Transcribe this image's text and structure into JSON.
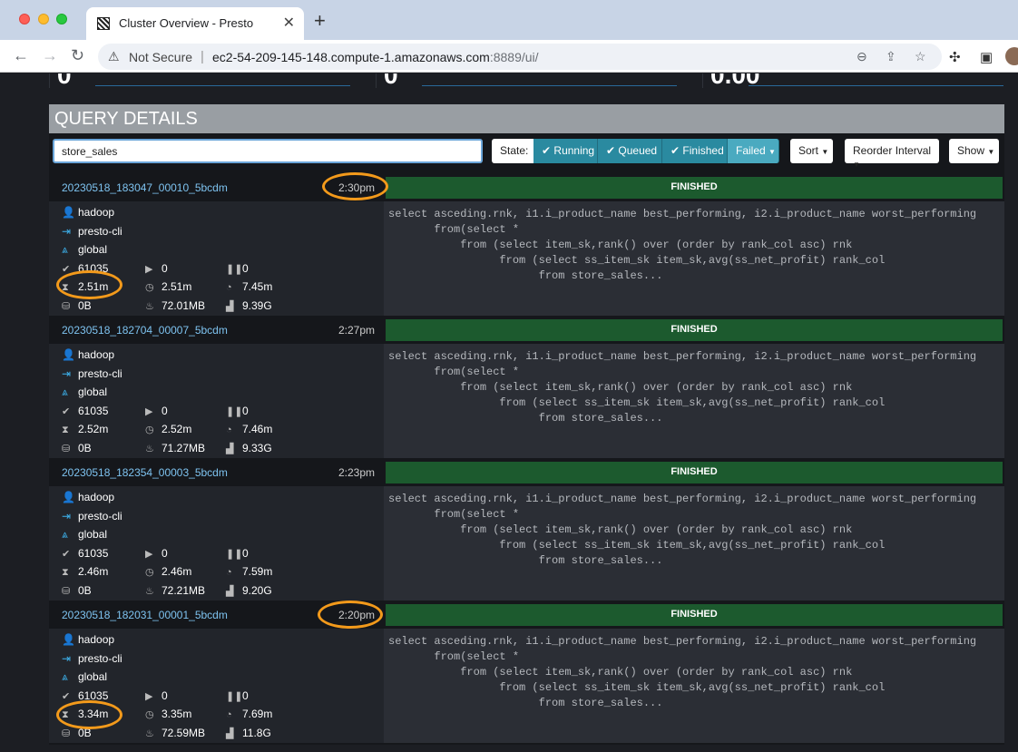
{
  "browser": {
    "tab_title": "Cluster Overview - Presto",
    "not_secure": "Not Secure",
    "url_host": "ec2-54-209-145-148.compute-1.amazonaws.com",
    "url_rest": ":8889/ui/"
  },
  "section": {
    "title": "QUERY DETAILS"
  },
  "filters": {
    "search_value": "store_sales",
    "state_label": "State:",
    "running": "Running",
    "queued": "Queued",
    "finished": "Finished",
    "failed": "Failed",
    "sort": "Sort",
    "reorder": "Reorder Interval",
    "show": "Show"
  },
  "queries": [
    {
      "id": "20230518_183047_00010_5bcdm",
      "time": "2:30pm",
      "status": "FINISHED",
      "user": "hadoop",
      "source": "presto-cli",
      "resource_group": "global",
      "completed_splits": "61035",
      "running_splits": "0",
      "queued_splits": "0",
      "wall_time": "2.51m",
      "elapsed_time": "2.51m",
      "cpu_time": "7.45m",
      "memory": "0B",
      "peak_memory": "72.01MB",
      "cumulative": "9.39G"
    },
    {
      "id": "20230518_182704_00007_5bcdm",
      "time": "2:27pm",
      "status": "FINISHED",
      "user": "hadoop",
      "source": "presto-cli",
      "resource_group": "global",
      "completed_splits": "61035",
      "running_splits": "0",
      "queued_splits": "0",
      "wall_time": "2.52m",
      "elapsed_time": "2.52m",
      "cpu_time": "7.46m",
      "memory": "0B",
      "peak_memory": "71.27MB",
      "cumulative": "9.33G"
    },
    {
      "id": "20230518_182354_00003_5bcdm",
      "time": "2:23pm",
      "status": "FINISHED",
      "user": "hadoop",
      "source": "presto-cli",
      "resource_group": "global",
      "completed_splits": "61035",
      "running_splits": "0",
      "queued_splits": "0",
      "wall_time": "2.46m",
      "elapsed_time": "2.46m",
      "cpu_time": "7.59m",
      "memory": "0B",
      "peak_memory": "72.21MB",
      "cumulative": "9.20G"
    },
    {
      "id": "20230518_182031_00001_5bcdm",
      "time": "2:20pm",
      "status": "FINISHED",
      "user": "hadoop",
      "source": "presto-cli",
      "resource_group": "global",
      "completed_splits": "61035",
      "running_splits": "0",
      "queued_splits": "0",
      "wall_time": "3.34m",
      "elapsed_time": "3.35m",
      "cpu_time": "7.69m",
      "memory": "0B",
      "peak_memory": "72.59MB",
      "cumulative": "11.8G"
    }
  ],
  "query_text": "select asceding.rnk, i1.i_product_name best_performing, i2.i_product_name worst_performing\n       from(select *\n           from (select item_sk,rank() over (order by rank_col asc) rnk\n                 from (select ss_item_sk item_sk,avg(ss_net_profit) rank_col\n                       from store_sales..."
}
